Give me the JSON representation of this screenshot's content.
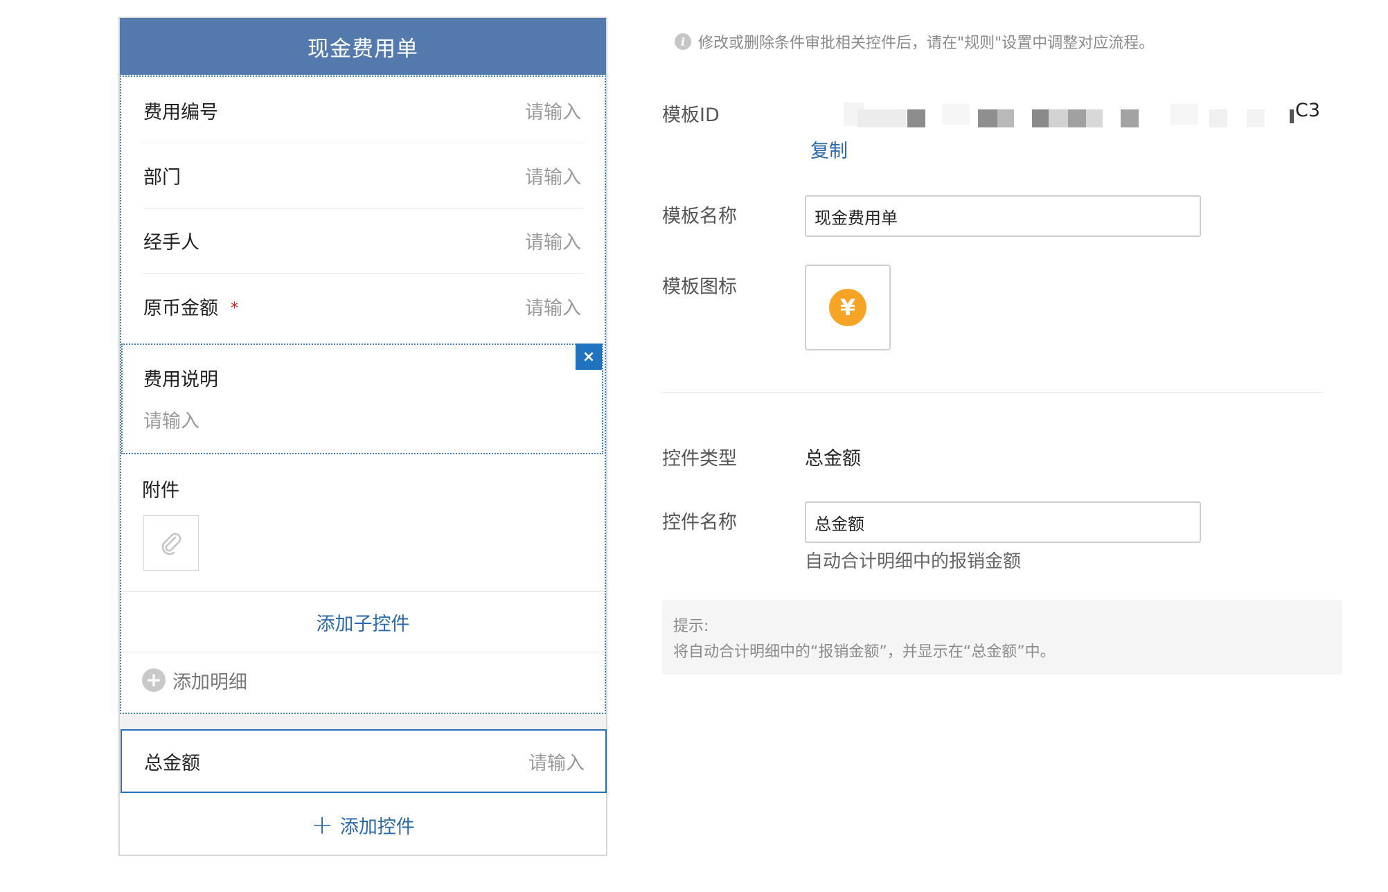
{
  "form": {
    "title": "现金费用单",
    "fields": [
      {
        "label": "费用编号",
        "placeholder": "请输入"
      },
      {
        "label": "部门",
        "placeholder": "请输入"
      },
      {
        "label": "经手人",
        "placeholder": "请输入"
      },
      {
        "label": "原币金额",
        "placeholder": "请输入",
        "required_mark": "*"
      }
    ],
    "description": {
      "label": "费用说明",
      "placeholder": "请输入",
      "close_glyph": "×"
    },
    "attachment": {
      "label": "附件",
      "icon": "paperclip-icon"
    },
    "add_sub_control": "添加子控件",
    "add_detail": "添加明细",
    "add_detail_glyph": "+",
    "total": {
      "label": "总金额",
      "placeholder": "请输入"
    },
    "add_control": "添加控件",
    "add_control_glyph": "+"
  },
  "settings": {
    "notice": "修改或删除条件审批相关控件后，请在\"规则\"设置中调整对应流程。",
    "notice_icon_glyph": "i",
    "template_id_label": "模板ID",
    "template_id_suffix": "C3",
    "copy_label": "复制",
    "template_name_label": "模板名称",
    "template_name_value": "现金费用单",
    "template_icon_label": "模板图标",
    "template_icon_glyph": "¥",
    "control_type_label": "控件类型",
    "control_type_value": "总金额",
    "control_name_label": "控件名称",
    "control_name_value": "总金额",
    "control_hint": "自动合计明细中的报销金额",
    "tip_title": "提示:",
    "tip_text": "将自动合计明细中的“报销金额”，并显示在“总金额”中。"
  },
  "colors": {
    "header": "#5379ad",
    "link": "#2b6aa8",
    "selected_border": "#2a70b8",
    "close_button": "#1f73c0",
    "required": "#e0201c",
    "icon_orange": "#f7a426"
  }
}
